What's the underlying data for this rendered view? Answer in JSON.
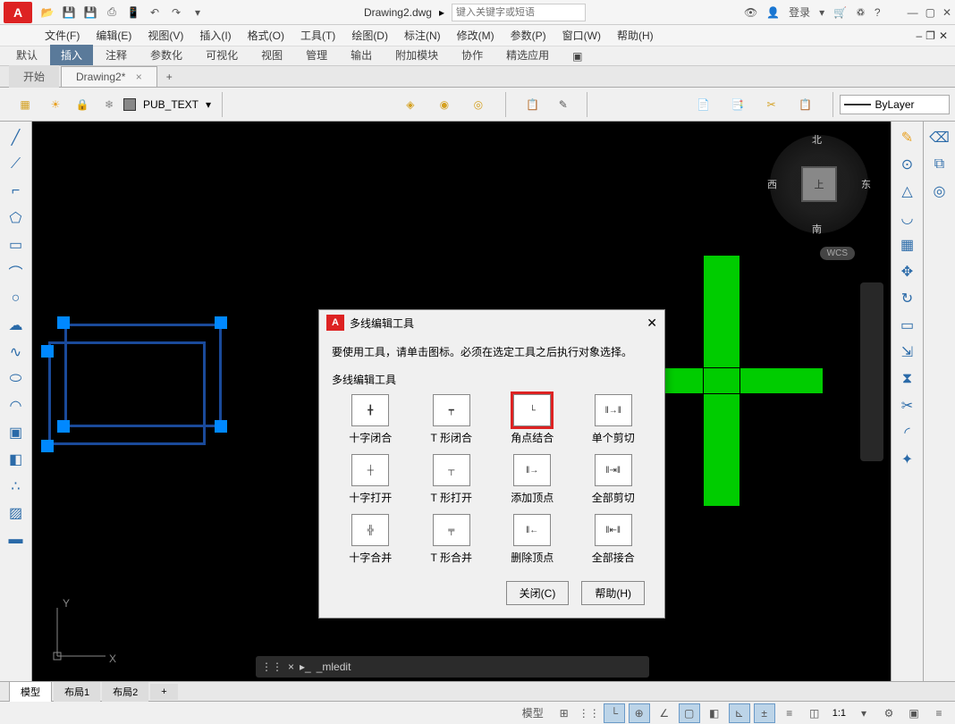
{
  "title": {
    "doc": "Drawing2.dwg",
    "search_placeholder": "键入关键字或短语",
    "login": "登录"
  },
  "menus": [
    "文件(F)",
    "编辑(E)",
    "视图(V)",
    "插入(I)",
    "格式(O)",
    "工具(T)",
    "绘图(D)",
    "标注(N)",
    "修改(M)",
    "参数(P)",
    "窗口(W)",
    "帮助(H)"
  ],
  "ribbon_tabs": [
    "默认",
    "插入",
    "注释",
    "参数化",
    "可视化",
    "视图",
    "管理",
    "输出",
    "附加模块",
    "协作",
    "精选应用"
  ],
  "ribbon_active": 1,
  "file_tabs": {
    "start": "开始",
    "doc": "Drawing2*",
    "add": "+"
  },
  "layer": {
    "name": "PUB_TEXT",
    "bylayer": "ByLayer"
  },
  "viewcube": {
    "top": "上",
    "n": "北",
    "s": "南",
    "e": "东",
    "w": "西",
    "wcs": "WCS"
  },
  "ucs": {
    "x": "X",
    "y": "Y"
  },
  "cmd": {
    "text": "_mledit"
  },
  "dialog": {
    "title": "多线编辑工具",
    "hint": "要使用工具，请单击图标。必须在选定工具之后执行对象选择。",
    "section": "多线编辑工具",
    "tools": [
      {
        "label": "十字闭合",
        "sel": false
      },
      {
        "label": "T 形闭合",
        "sel": false
      },
      {
        "label": "角点结合",
        "sel": true
      },
      {
        "label": "单个剪切",
        "sel": false
      },
      {
        "label": "十字打开",
        "sel": false
      },
      {
        "label": "T 形打开",
        "sel": false
      },
      {
        "label": "添加顶点",
        "sel": false
      },
      {
        "label": "全部剪切",
        "sel": false
      },
      {
        "label": "十字合并",
        "sel": false
      },
      {
        "label": "T 形合并",
        "sel": false
      },
      {
        "label": "删除顶点",
        "sel": false
      },
      {
        "label": "全部接合",
        "sel": false
      }
    ],
    "close": "关闭(C)",
    "help": "帮助(H)"
  },
  "bottom_tabs": [
    "模型",
    "布局1",
    "布局2"
  ],
  "status": {
    "model": "模型",
    "scale": "1:1"
  }
}
